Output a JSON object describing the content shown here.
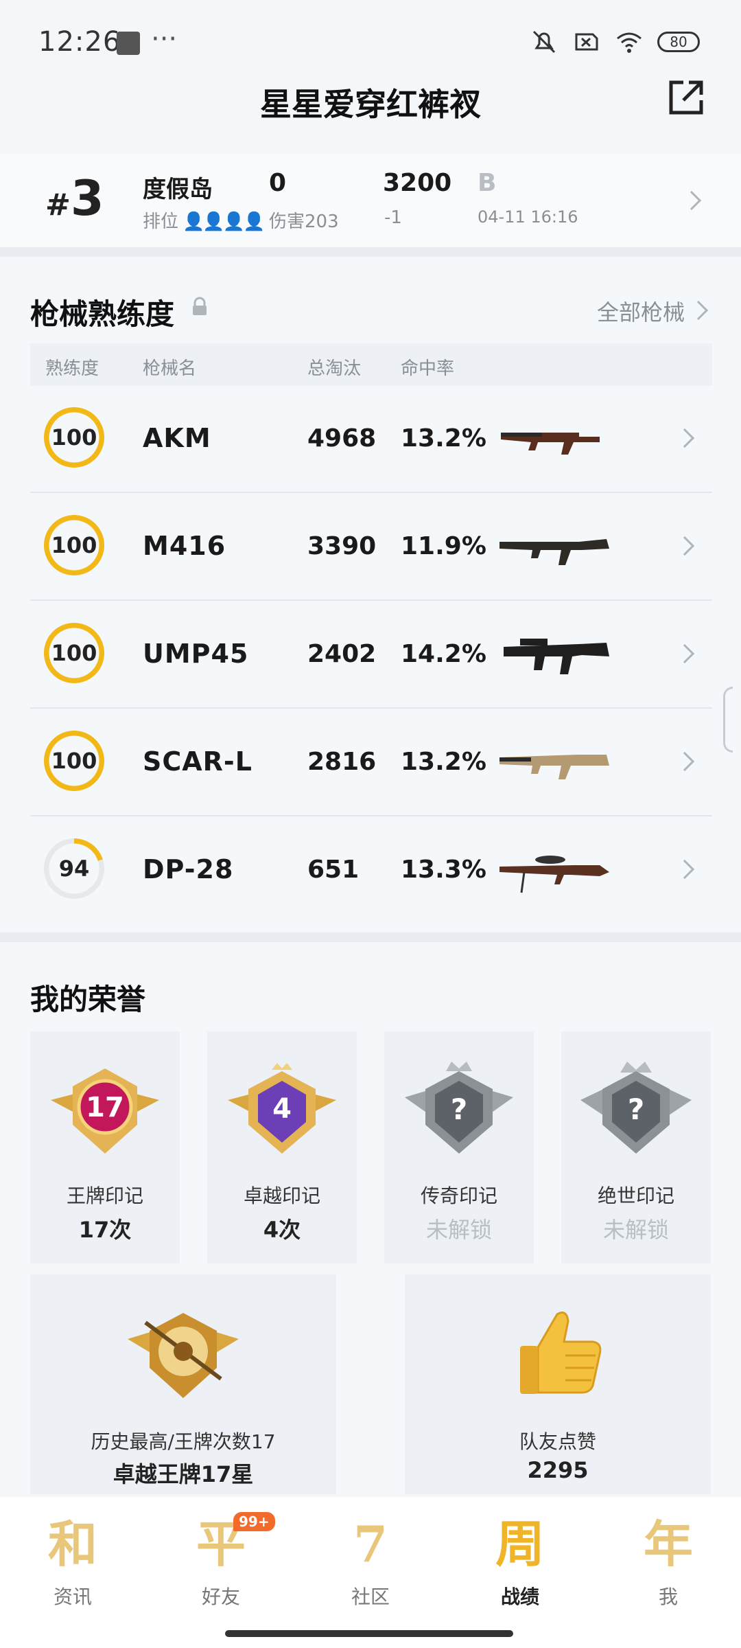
{
  "status_bar": {
    "time": "12:26",
    "battery": "80"
  },
  "header": {
    "title": "星星爱穿红裤衩"
  },
  "match": {
    "rank_hash": "#",
    "rank_num": "3",
    "map": "度假岛",
    "rank_label": "排位",
    "kills": "0",
    "damage": "伤害203",
    "score": "3200",
    "score_delta": "-1",
    "tier": "B",
    "date": "04-11 16:16"
  },
  "weapons": {
    "title": "枪械熟练度",
    "all_link": "全部枪械",
    "columns": [
      "熟练度",
      "枪械名",
      "总淘汰",
      "命中率"
    ],
    "rows": [
      {
        "mastery": "100",
        "progress": 1.0,
        "name": "AKM",
        "kills": "4968",
        "accuracy": "13.2%",
        "icon": "akm-rifle"
      },
      {
        "mastery": "100",
        "progress": 1.0,
        "name": "M416",
        "kills": "3390",
        "accuracy": "11.9%",
        "icon": "m416-rifle"
      },
      {
        "mastery": "100",
        "progress": 1.0,
        "name": "UMP45",
        "kills": "2402",
        "accuracy": "14.2%",
        "icon": "ump45-smg"
      },
      {
        "mastery": "100",
        "progress": 1.0,
        "name": "SCAR-L",
        "kills": "2816",
        "accuracy": "13.2%",
        "icon": "scar-l-rifle"
      },
      {
        "mastery": "94",
        "progress": 0.2,
        "name": "DP-28",
        "kills": "651",
        "accuracy": "13.3%",
        "icon": "dp28-lmg"
      }
    ]
  },
  "honors": {
    "title": "我的荣誉",
    "cards": [
      {
        "label": "王牌印记",
        "value": "17次",
        "badge_text": "17",
        "locked": false
      },
      {
        "label": "卓越印记",
        "value": "4次",
        "badge_text": "4",
        "locked": false
      },
      {
        "label": "传奇印记",
        "value": "未解锁",
        "badge_text": "?",
        "locked": true
      },
      {
        "label": "绝世印记",
        "value": "未解锁",
        "badge_text": "?",
        "locked": true
      }
    ],
    "best": {
      "label": "历史最高/王牌次数17",
      "value": "卓越王牌17星"
    },
    "likes": {
      "label": "队友点赞",
      "value": "2295"
    }
  },
  "nav": {
    "items": [
      {
        "glyph": "和",
        "label": "资讯"
      },
      {
        "glyph": "平",
        "label": "好友",
        "badge": "99+"
      },
      {
        "glyph": "7",
        "label": "社区"
      },
      {
        "glyph": "周",
        "label": "战绩",
        "active": true
      },
      {
        "glyph": "年",
        "label": "我"
      }
    ]
  },
  "colors": {
    "ring_gold": "#f2b817",
    "ring_track": "#e6e8eb",
    "nav_gold": "#e9c77a",
    "accent_orange": "#f36b2b"
  }
}
